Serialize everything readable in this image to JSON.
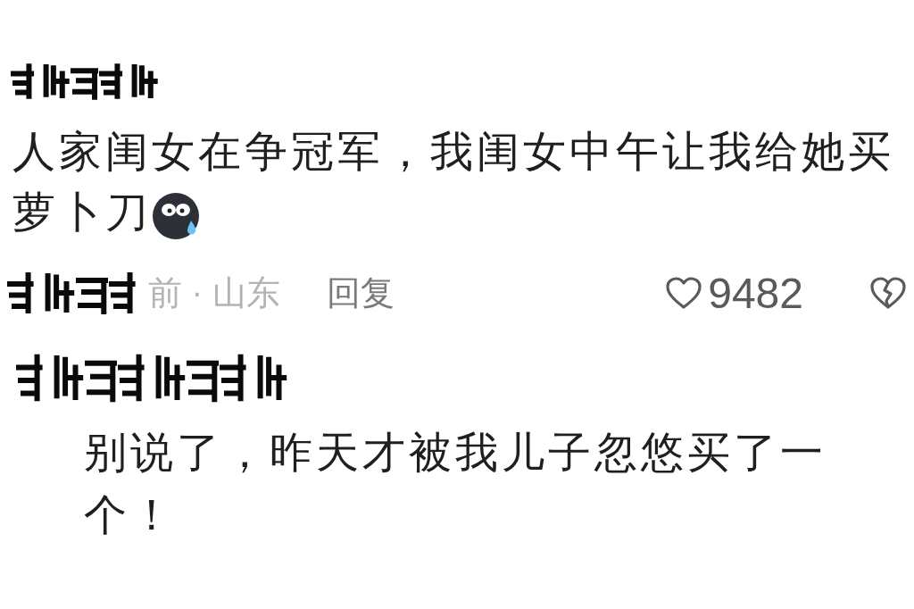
{
  "comments": [
    {
      "kind": "comment",
      "lines": [
        "人家闺女在争冠军，我闺女中午让我给她买",
        "萝卜刀"
      ],
      "sticker": true,
      "meta": "前 · 山东",
      "reply_label": "回复",
      "likes": "9482"
    },
    {
      "kind": "reply",
      "text": "别说了，昨天才被我儿子忽悠买了一个！",
      "sticker": false
    }
  ]
}
